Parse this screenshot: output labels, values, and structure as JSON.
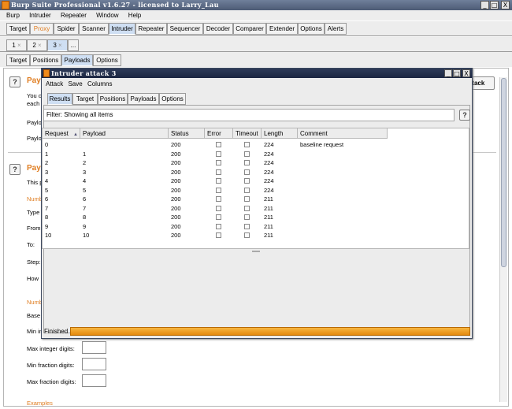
{
  "app": {
    "title": "Burp Suite Professional v1.6.27 - licensed to Larry_Lau",
    "menu": [
      "Burp",
      "Intruder",
      "Repeater",
      "Window",
      "Help"
    ],
    "window_buttons": [
      "_",
      "□",
      "X"
    ]
  },
  "main_tabs": [
    "Target",
    "Proxy",
    "Spider",
    "Scanner",
    "Intruder",
    "Repeater",
    "Sequencer",
    "Decoder",
    "Comparer",
    "Extender",
    "Options",
    "Alerts"
  ],
  "attack_tabs": [
    "1",
    "2",
    "3",
    "..."
  ],
  "attack_tab_close": "×",
  "sub_tabs": [
    "Target",
    "Positions",
    "Payloads",
    "Options"
  ],
  "payloads_panel": {
    "help": "?",
    "section1_title": "Payl",
    "section1_text_1": "You c",
    "section1_text_2": "each",
    "payload_set_label": "Paylo",
    "payload_type_label": "Paylo",
    "start_attack_label": "ttack",
    "section2_title": "Pay",
    "section2_text": "This p",
    "number_range_label": "Numb",
    "type_label": "Type",
    "from_label": "From",
    "to_label": "To:",
    "step_label": "Step:",
    "how_label": "How",
    "number_format_label": "Numb",
    "base_label": "Base",
    "min_int_label": "Min in",
    "max_int_label": "Max integer digits:",
    "min_frac_label": "Min fraction digits:",
    "max_frac_label": "Max fraction digits:",
    "examples_label": "Examples"
  },
  "popup": {
    "title": "Intruder attack 3",
    "menu": [
      "Attack",
      "Save",
      "Columns"
    ],
    "tabs": [
      "Results",
      "Target",
      "Positions",
      "Payloads",
      "Options"
    ],
    "filter_text": "Filter:  Showing all items",
    "filter_help": "?",
    "columns": [
      "Request",
      "Payload",
      "Status",
      "Error",
      "Timeout",
      "Length",
      "Comment"
    ],
    "sort_indicator": "▲",
    "rows": [
      {
        "request": "0",
        "payload": "",
        "status": "200",
        "error": false,
        "timeout": false,
        "length": "224",
        "comment": "baseline request"
      },
      {
        "request": "1",
        "payload": "1",
        "status": "200",
        "error": false,
        "timeout": false,
        "length": "224",
        "comment": ""
      },
      {
        "request": "2",
        "payload": "2",
        "status": "200",
        "error": false,
        "timeout": false,
        "length": "224",
        "comment": ""
      },
      {
        "request": "3",
        "payload": "3",
        "status": "200",
        "error": false,
        "timeout": false,
        "length": "224",
        "comment": ""
      },
      {
        "request": "4",
        "payload": "4",
        "status": "200",
        "error": false,
        "timeout": false,
        "length": "224",
        "comment": ""
      },
      {
        "request": "5",
        "payload": "5",
        "status": "200",
        "error": false,
        "timeout": false,
        "length": "224",
        "comment": ""
      },
      {
        "request": "6",
        "payload": "6",
        "status": "200",
        "error": false,
        "timeout": false,
        "length": "211",
        "comment": ""
      },
      {
        "request": "7",
        "payload": "7",
        "status": "200",
        "error": false,
        "timeout": false,
        "length": "211",
        "comment": ""
      },
      {
        "request": "8",
        "payload": "8",
        "status": "200",
        "error": false,
        "timeout": false,
        "length": "211",
        "comment": ""
      },
      {
        "request": "9",
        "payload": "9",
        "status": "200",
        "error": false,
        "timeout": false,
        "length": "211",
        "comment": ""
      },
      {
        "request": "10",
        "payload": "10",
        "status": "200",
        "error": false,
        "timeout": false,
        "length": "211",
        "comment": ""
      }
    ],
    "status_text": "Finished",
    "progress_fraction": 1.0
  },
  "colors": {
    "accent_orange": "#e07e22",
    "progress": "#f0a020",
    "selected_tab": "#cfdff3"
  }
}
